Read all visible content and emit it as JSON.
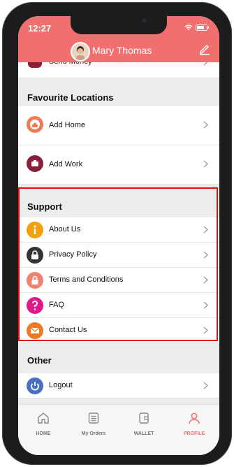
{
  "status": {
    "time": "12:27"
  },
  "header": {
    "user_name": "Mary Thomas"
  },
  "top_partial_row": {
    "label": "Send Money"
  },
  "sections": {
    "favourite": "Favourite Locations",
    "support": "Support",
    "other": "Other"
  },
  "favourite_items": [
    "Add Home",
    "Add Work"
  ],
  "support_items": [
    "About Us",
    "Privacy Policy",
    "Terms and Conditions",
    "FAQ",
    "Contact Us"
  ],
  "other_items": [
    "Logout"
  ],
  "tabs": [
    "HOME",
    "My Orders",
    "WALLET",
    "PROFILE"
  ],
  "colors": {
    "accent": "#f26f6f",
    "highlight": "#e01010",
    "active_tab": "#f26f6f"
  }
}
